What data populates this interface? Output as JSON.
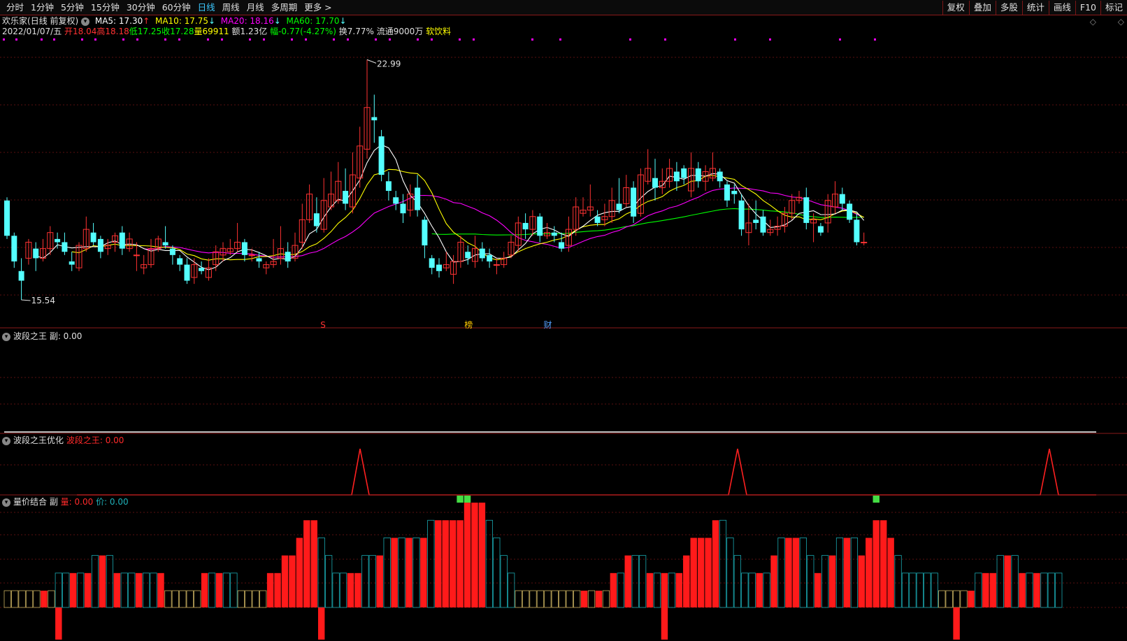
{
  "toolbar": {
    "left": [
      "分时",
      "1分钟",
      "5分钟",
      "15分钟",
      "30分钟",
      "60分钟",
      "日线",
      "周线",
      "月线",
      "多周期",
      "更多 >"
    ],
    "active_index": 6,
    "right": [
      "复权",
      "叠加",
      "多股",
      "统计",
      "画线",
      "F10",
      "标记"
    ]
  },
  "main_chart": {
    "stock_name": "欢乐家",
    "period_label": "(日线 前复权)",
    "ma5": "MA5: 17.30",
    "ma10": "MA10: 17.75",
    "ma20": "MA20: 18.16",
    "ma60": "MA60: 17.70",
    "arrow_up": "↑",
    "arrow_down": "↓",
    "date": "2022/01/07/五",
    "open": "开18.04",
    "high": "高18.18",
    "low": "低17.25",
    "close": "收17.28",
    "volume": "量69911",
    "amount": "额1.23亿",
    "change": "幅-0.77(-4.27%)",
    "turnover": "换7.77%",
    "float_shares": "流通9000万",
    "industry": "软饮料",
    "max_label": "22.99",
    "min_label": "15.54",
    "events": [
      "S",
      "榜",
      "财"
    ],
    "colors": {
      "ma5": "#ffffff",
      "ma10": "#ffff00",
      "ma20": "#ff00ff",
      "ma60": "#00ff00",
      "up": "#ff3232",
      "down": "#54ffff"
    }
  },
  "panels": {
    "p1_title": "波段之王 副",
    "p1_value": ": 0.00",
    "p2_title": "波段之王优化",
    "p2_series": "波段之王: 0.00",
    "p3_title": "量价结合 副",
    "p3_vol": "量: 0.00",
    "p3_price": "价: 0.00"
  },
  "chart_data": {
    "type": "candlestick",
    "ylim": [
      15.0,
      23.5
    ],
    "candles": [
      [
        18.6,
        17.5,
        18.7,
        17.4
      ],
      [
        17.5,
        16.7,
        17.6,
        16.5
      ],
      [
        16.4,
        16.1,
        16.8,
        15.5
      ],
      [
        16.8,
        17.3,
        17.4,
        16.6
      ],
      [
        17.1,
        16.8,
        17.3,
        16.4
      ],
      [
        16.8,
        17.1,
        17.4,
        16.7
      ],
      [
        17.1,
        17.6,
        17.8,
        16.9
      ],
      [
        17.4,
        17.3,
        17.6,
        17.1
      ],
      [
        17.3,
        17.0,
        17.6,
        16.9
      ],
      [
        16.7,
        16.6,
        17.0,
        16.4
      ],
      [
        16.5,
        17.2,
        17.3,
        16.4
      ],
      [
        17.1,
        17.7,
        18.1,
        17.0
      ],
      [
        17.6,
        17.3,
        17.9,
        17.2
      ],
      [
        17.4,
        17.0,
        17.5,
        16.8
      ],
      [
        17.1,
        17.2,
        17.4,
        16.9
      ],
      [
        17.3,
        17.5,
        17.6,
        17.0
      ],
      [
        17.6,
        17.1,
        17.8,
        16.9
      ],
      [
        17.1,
        17.4,
        17.6,
        17.0
      ],
      [
        16.9,
        16.9,
        17.3,
        16.4
      ],
      [
        16.5,
        16.6,
        16.9,
        16.3
      ],
      [
        16.6,
        17.1,
        17.4,
        16.5
      ],
      [
        17.1,
        17.4,
        17.5,
        17.0
      ],
      [
        17.3,
        17.2,
        17.8,
        17.1
      ],
      [
        17.1,
        16.9,
        17.2,
        16.6
      ],
      [
        16.8,
        16.6,
        16.9,
        16.4
      ],
      [
        16.6,
        16.1,
        16.8,
        16.0
      ],
      [
        16.2,
        16.6,
        16.8,
        16.0
      ],
      [
        16.5,
        16.4,
        16.7,
        16.3
      ],
      [
        16.2,
        16.5,
        16.8,
        16.1
      ],
      [
        16.6,
        17.0,
        17.2,
        16.4
      ],
      [
        16.9,
        17.1,
        17.3,
        16.7
      ],
      [
        17.0,
        17.1,
        17.4,
        16.9
      ],
      [
        17.1,
        17.3,
        17.9,
        17.0
      ],
      [
        17.3,
        16.9,
        17.4,
        16.7
      ],
      [
        16.9,
        16.9,
        17.1,
        16.7
      ],
      [
        16.8,
        16.7,
        17.0,
        16.5
      ],
      [
        16.5,
        16.6,
        16.7,
        16.3
      ],
      [
        16.6,
        16.7,
        17.4,
        16.5
      ],
      [
        16.8,
        17.1,
        17.8,
        16.6
      ],
      [
        17.0,
        16.7,
        17.3,
        16.5
      ],
      [
        16.8,
        17.2,
        17.6,
        16.7
      ],
      [
        17.3,
        18.0,
        18.5,
        17.1
      ],
      [
        18.0,
        18.8,
        19.1,
        17.9
      ],
      [
        18.2,
        17.8,
        18.7,
        17.6
      ],
      [
        17.7,
        18.6,
        19.3,
        17.6
      ],
      [
        18.4,
        18.8,
        19.5,
        18.3
      ],
      [
        18.6,
        19.2,
        19.8,
        18.5
      ],
      [
        18.9,
        18.5,
        19.6,
        18.3
      ],
      [
        18.4,
        19.4,
        20.1,
        18.2
      ],
      [
        19.3,
        20.3,
        20.9,
        19.0
      ],
      [
        20.2,
        21.5,
        22.99,
        19.9
      ],
      [
        21.2,
        21.1,
        21.9,
        20.4
      ],
      [
        20.6,
        19.4,
        20.8,
        19.2
      ],
      [
        19.2,
        18.9,
        19.5,
        18.6
      ],
      [
        18.7,
        18.5,
        18.9,
        18.3
      ],
      [
        18.5,
        18.2,
        18.8,
        17.9
      ],
      [
        18.3,
        18.8,
        19.1,
        18.1
      ],
      [
        19.0,
        18.3,
        19.4,
        18.1
      ],
      [
        18.0,
        17.2,
        18.1,
        16.8
      ],
      [
        16.8,
        16.5,
        16.9,
        16.3
      ],
      [
        16.6,
        16.4,
        16.8,
        16.2
      ],
      [
        16.5,
        16.6,
        17.0,
        16.4
      ],
      [
        16.3,
        16.7,
        16.9,
        16.0
      ],
      [
        16.7,
        17.3,
        17.5,
        16.5
      ],
      [
        17.0,
        16.8,
        17.2,
        16.6
      ],
      [
        16.7,
        17.1,
        17.5,
        16.5
      ],
      [
        17.1,
        16.8,
        17.3,
        16.7
      ],
      [
        16.9,
        16.7,
        17.1,
        16.5
      ],
      [
        16.6,
        16.6,
        16.8,
        16.3
      ],
      [
        16.6,
        16.8,
        17.0,
        16.5
      ],
      [
        16.9,
        17.3,
        17.5,
        16.8
      ],
      [
        17.2,
        17.9,
        18.1,
        17.0
      ],
      [
        17.9,
        17.7,
        18.2,
        17.4
      ],
      [
        17.7,
        18.1,
        18.3,
        17.5
      ],
      [
        18.1,
        17.5,
        18.2,
        17.3
      ],
      [
        17.5,
        17.6,
        17.9,
        17.4
      ],
      [
        17.6,
        17.5,
        17.8,
        17.3
      ],
      [
        17.3,
        17.1,
        17.6,
        17.0
      ],
      [
        17.2,
        17.7,
        18.1,
        17.0
      ],
      [
        17.7,
        18.4,
        18.7,
        17.5
      ],
      [
        18.2,
        18.3,
        18.7,
        18.1
      ],
      [
        18.3,
        18.4,
        19.1,
        18.1
      ],
      [
        18.1,
        17.9,
        18.3,
        17.8
      ],
      [
        18.0,
        18.1,
        18.5,
        17.8
      ],
      [
        18.1,
        18.6,
        19.0,
        17.9
      ],
      [
        18.5,
        18.3,
        19.3,
        18.2
      ],
      [
        18.5,
        19.0,
        19.4,
        18.4
      ],
      [
        19.0,
        18.1,
        19.2,
        17.9
      ],
      [
        18.2,
        19.4,
        19.6,
        18.1
      ],
      [
        19.2,
        19.6,
        20.2,
        19.1
      ],
      [
        19.3,
        19.0,
        19.9,
        18.6
      ],
      [
        19.0,
        19.2,
        19.6,
        18.8
      ],
      [
        19.2,
        19.6,
        19.9,
        19.0
      ],
      [
        19.5,
        19.2,
        19.8,
        18.9
      ],
      [
        19.6,
        19.3,
        19.7,
        19.1
      ],
      [
        18.9,
        19.6,
        20.1,
        18.7
      ],
      [
        19.6,
        19.2,
        19.8,
        19.0
      ],
      [
        19.2,
        19.5,
        19.7,
        18.9
      ],
      [
        19.3,
        19.6,
        20.1,
        19.2
      ],
      [
        19.5,
        19.2,
        19.6,
        19.0
      ],
      [
        19.1,
        18.6,
        19.2,
        18.4
      ],
      [
        18.9,
        18.8,
        19.1,
        18.5
      ],
      [
        18.6,
        17.7,
        18.8,
        17.5
      ],
      [
        17.6,
        17.9,
        18.5,
        17.2
      ],
      [
        18.0,
        17.9,
        18.6,
        17.7
      ],
      [
        18.1,
        17.6,
        18.3,
        17.5
      ],
      [
        17.6,
        17.7,
        18.0,
        17.5
      ],
      [
        17.7,
        17.8,
        18.1,
        17.5
      ],
      [
        17.8,
        18.2,
        18.4,
        17.6
      ],
      [
        18.2,
        18.6,
        18.8,
        18.0
      ],
      [
        18.6,
        18.7,
        18.9,
        18.5
      ],
      [
        18.7,
        17.9,
        19.0,
        17.7
      ],
      [
        17.9,
        18.0,
        18.2,
        17.3
      ],
      [
        17.8,
        17.6,
        17.9,
        17.5
      ],
      [
        17.9,
        18.6,
        18.8,
        17.6
      ],
      [
        18.4,
        18.8,
        19.2,
        18.2
      ],
      [
        18.8,
        18.5,
        19.0,
        18.3
      ],
      [
        18.5,
        18.0,
        18.6,
        17.9
      ],
      [
        18.0,
        17.3,
        18.2,
        17.2
      ],
      [
        17.3,
        17.3,
        17.6,
        17.2
      ]
    ]
  }
}
